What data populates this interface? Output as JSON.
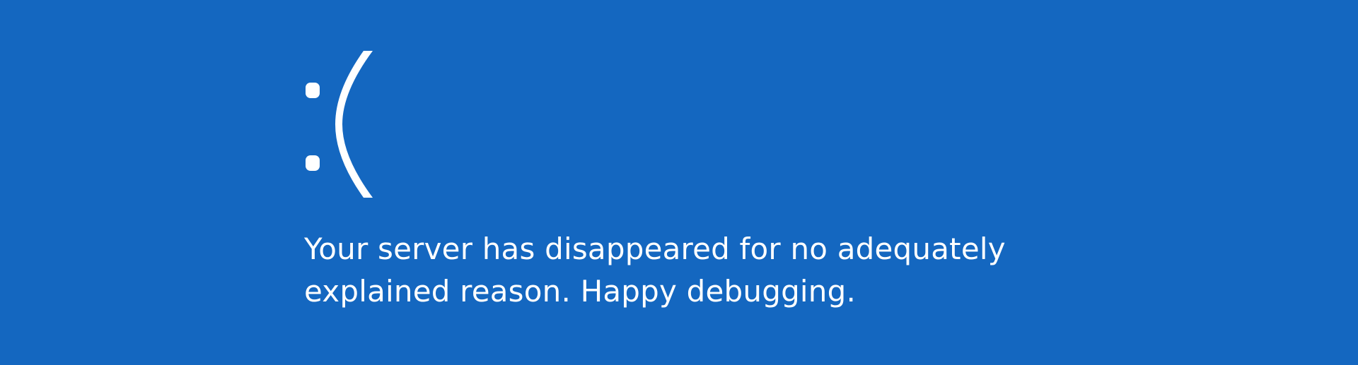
{
  "screen": {
    "background_color": "#1467c0",
    "text_color": "#ffffff",
    "face_icon": "sad-face-icon",
    "message_line1": "Your server has disappeared for no adequately",
    "message_line2": "explained reason. Happy debugging."
  }
}
